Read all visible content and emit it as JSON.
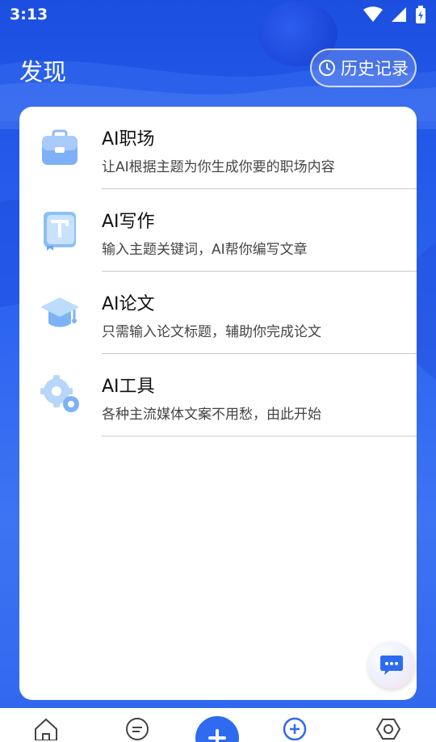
{
  "status_bar": {
    "time": "3:13"
  },
  "header": {
    "title": "发现",
    "history_label": "历史记录"
  },
  "items": [
    {
      "title": "AI职场",
      "desc": "让AI根据主题为你生成你要的职场内容",
      "icon": "briefcase-icon"
    },
    {
      "title": "AI写作",
      "desc": "输入主题关键词，AI帮你编写文章",
      "icon": "book-icon"
    },
    {
      "title": "AI论文",
      "desc": "只需输入论文标题，辅助你完成论文",
      "icon": "graduation-cap-icon"
    },
    {
      "title": "AI工具",
      "desc": "各种主流媒体文案不用愁，由此开始",
      "icon": "gear-icon"
    }
  ],
  "bottom_nav": {
    "items": [
      "home-icon",
      "message-icon",
      "add-center-icon",
      "add-circle-icon",
      "settings-icon"
    ]
  },
  "colors": {
    "accent": "#2f6bf0",
    "background": "#2a63f0"
  }
}
